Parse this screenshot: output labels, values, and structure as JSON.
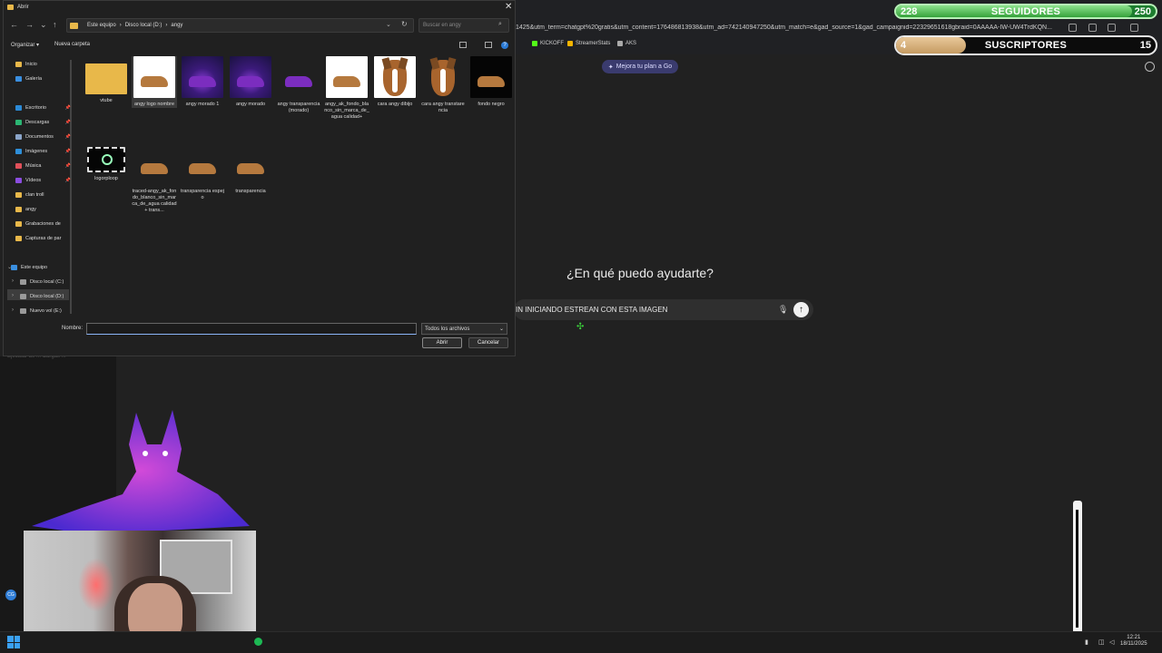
{
  "browser": {
    "url_fragment": "1425&utm_term=chatgpt%20gratis&utm_content=176486813938&utm_ad=742140947250&utm_match=e&gad_source=1&gad_campaignid=22329651618gbraid=0AAAAA-IW-UW4TrdKQN...",
    "bookmarks": [
      {
        "label": "KICKOFF",
        "icon": "kick-icon",
        "color": "#53fc18"
      },
      {
        "label": "StreamerStats",
        "icon": "bar-chart-icon",
        "color": "#f5b400"
      },
      {
        "label": "AKS",
        "icon": "dots-icon",
        "color": "#aaaaaa"
      }
    ]
  },
  "overlays": {
    "followers": {
      "current": "228",
      "label": "SEGUIDORES",
      "goal": "250",
      "progress": 0.91
    },
    "subscribers": {
      "current": "4",
      "label": "SUSCRIPTORES",
      "goal": "15",
      "progress": 0.27
    }
  },
  "chat": {
    "upgrade_label": "Mejora tu plan a Go",
    "title": "¿En qué puedo ayudarte?",
    "prompt_text": "IN INICIANDO ESTREAN CON ESTA IMAGEN"
  },
  "dialog": {
    "title": "Abrir",
    "breadcrumb": [
      "Este equipo",
      "Disco local (D:)",
      "angy"
    ],
    "search_placeholder": "Buscar en angy",
    "toolbar": {
      "organize": "Organizar ▾",
      "new_folder": "Nueva carpeta"
    },
    "nav": [
      {
        "label": "Inicio",
        "icon": "home-icon",
        "color": "#e8b84a",
        "pinned": false
      },
      {
        "label": "Galería",
        "icon": "gallery-icon",
        "color": "#3a8fe0",
        "pinned": false
      },
      {
        "label": "Escritorio",
        "icon": "desktop-icon",
        "color": "#2b8ad6",
        "pinned": true
      },
      {
        "label": "Descargas",
        "icon": "download-icon",
        "color": "#2bb673",
        "pinned": true
      },
      {
        "label": "Documentos",
        "icon": "document-icon",
        "color": "#8aa4c8",
        "pinned": true
      },
      {
        "label": "Imágenes",
        "icon": "image-icon",
        "color": "#2e8fd9",
        "pinned": true
      },
      {
        "label": "Música",
        "icon": "music-icon",
        "color": "#e0505a",
        "pinned": true
      },
      {
        "label": "Vídeos",
        "icon": "video-icon",
        "color": "#8b4de0",
        "pinned": true
      },
      {
        "label": "clan troll",
        "icon": "folder-icon",
        "color": "#e8b84a",
        "pinned": false
      },
      {
        "label": "angy",
        "icon": "folder-icon",
        "color": "#e8b84a",
        "pinned": false
      },
      {
        "label": "Grabaciones de",
        "icon": "folder-icon",
        "color": "#e8b84a",
        "pinned": false
      },
      {
        "label": "Capturas de par",
        "icon": "folder-icon",
        "color": "#e8b84a",
        "pinned": false
      },
      {
        "label": "Este equipo",
        "icon": "computer-icon",
        "color": "#3a8fe0",
        "pinned": false
      },
      {
        "label": "Disco local (C:)",
        "icon": "drive-icon",
        "color": "#9a9a9a",
        "pinned": false
      },
      {
        "label": "Disco local (D:)",
        "icon": "drive-icon",
        "color": "#9a9a9a",
        "pinned": false
      },
      {
        "label": "Nuevo vol (E:)",
        "icon": "drive-icon",
        "color": "#9a9a9a",
        "pinned": false
      }
    ],
    "files": [
      {
        "name": "vtube",
        "kind": "folder"
      },
      {
        "name": "angy logo nombre",
        "kind": "white-dog",
        "selected": true
      },
      {
        "name": "angy morado 1",
        "kind": "purple"
      },
      {
        "name": "angy morado",
        "kind": "purple"
      },
      {
        "name": "angy transparencia (morado)",
        "kind": "purple-transparent"
      },
      {
        "name": "angy_ak_fondo_blanco_sin_marca_de_agua calidad+",
        "kind": "white-dog"
      },
      {
        "name": "cara angy dibijo",
        "kind": "face-white"
      },
      {
        "name": "cara angy transtarencia",
        "kind": "face-dark"
      },
      {
        "name": "fondo negro",
        "kind": "black-dog"
      },
      {
        "name": "logorploop",
        "kind": "logo"
      },
      {
        "name": "traced-angy_ak_fondo_blanco_sin_marca_de_agua calidad+ trans...",
        "kind": "dark-dog"
      },
      {
        "name": "transparencia espejo",
        "kind": "dark-dog"
      },
      {
        "name": "transparencia",
        "kind": "dark-dog"
      }
    ],
    "name_label": "Nombre:",
    "name_value": "",
    "filter_label": "Todos los archivos",
    "open_label": "Abrir",
    "cancel_label": "Cancelar"
  },
  "background_hint": "Ejecutar de ... Cargas ... ",
  "taskbar": {
    "time": "12:21",
    "date": "18/11/2025",
    "badge": "CG"
  }
}
